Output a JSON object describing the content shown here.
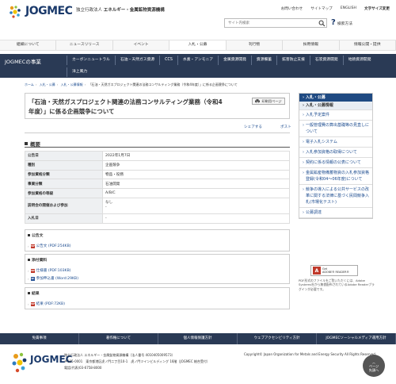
{
  "header": {
    "logo_text": "JOGMEC",
    "org_prefix": "独立行政法人",
    "org_name": "エネルギー・金属鉱物資源機構",
    "top_links": [
      "お問い合わせ",
      "サイトマップ",
      "ENGLISH",
      "文字サイズ変更"
    ],
    "search_placeholder": "サイト内検索",
    "search_help": "検索方法"
  },
  "global_nav": [
    "組織について",
    "ニュースリリース",
    "イベント",
    "入札・公募",
    "刊行物",
    "採用情報",
    "情報公開・提供"
  ],
  "business_bar": {
    "title": "JOGMECの事業",
    "links": [
      "カーボンニュートラル",
      "石油・天然ガス資源",
      "CCS",
      "水素・アンモニア",
      "金属資源開発",
      "資源備蓄",
      "鉱害防止支援",
      "石炭資源開発",
      "地熱資源開発",
      "洋上風力"
    ]
  },
  "breadcrumb": [
    "ホーム",
    "入札・公募",
    "入札・公募情報",
    "「石油・天然ガスプロジェクト関連の法務コンサルティング業務（令和4年度）」に係る企画競争について"
  ],
  "main": {
    "title": "「石油・天然ガスプロジェクト関連の法務コンサルティング業務（令和4年度）」に係る企画競争について",
    "print_label": "印刷用ページ",
    "share_label": "シェアする",
    "post_label": "ポスト",
    "overview_heading": "概要",
    "info_rows": [
      {
        "key": "公告日",
        "value": "2022年1月7日"
      },
      {
        "key": "種別",
        "value": "企画競争"
      },
      {
        "key": "参加資格分類",
        "value": "物品・役務"
      },
      {
        "key": "事業分類",
        "value": "石油開発"
      },
      {
        "key": "参加資格の等級",
        "value": "A/B/C"
      },
      {
        "key": "説明会の開催および参加",
        "value": "なし\n-"
      },
      {
        "key": "入札日",
        "value": "-"
      }
    ],
    "docs": [
      {
        "heading": "公告文",
        "items": [
          {
            "label": "公告文 (PDF:254KB)",
            "icon": "pdf-icon"
          }
        ]
      },
      {
        "heading": "添付資料",
        "items": [
          {
            "label": "仕様書 (PDF:103KB)",
            "icon": "pdf-icon"
          },
          {
            "label": "参加申込書 (Word:29KB)",
            "icon": "word-icon"
          }
        ]
      },
      {
        "heading": "結果",
        "items": [
          {
            "label": "結果 (PDF:72KB)",
            "icon": "pdf-icon"
          }
        ]
      }
    ]
  },
  "sidebar": {
    "heading": "入札・公募",
    "sub_heading": "入札・公募情報",
    "items": [
      "入札予定案件",
      "一般管理費の算出基礎等の見直しについて",
      "電子入札システム",
      "入札参加資格の取得について",
      "契約に係る情報の公表について",
      "金属鉱産物備蓄物資の入札参加資格登録(令和04～06年度)について",
      "競争の導入による公共サービスの改革に関する法律に基づく民間競争入札(市場化テスト)",
      "公募調達"
    ]
  },
  "adobe": {
    "get_label": "Get",
    "product_label": "ADOBE® READER®",
    "note": "PDF形式のファイルをご覧いただくには、Adobe Systems社から無償配布されているAdobe Readerプラグインが必要です。"
  },
  "footer_nav": [
    "免責事項",
    "著作権について",
    "個人情報保護方針",
    "ウェブアクセシビリティ方針",
    "JOGMECソーシャルメディア運用方針"
  ],
  "footer": {
    "logo_text": "JOGMEC",
    "address_lines": [
      "独立行政法人 エネルギー・金属鉱物資源機構（法人番号 4010405009573）",
      "〒105-0001　東京都港区虎ノ門二丁目10-1　虎ノ門ツインビルディング 16階（JOGMEC 総合受付）",
      "電話(代表)03-6758-8000"
    ],
    "copyright": "Copyright© Japan Organization for Metals and Energy Security All Rights Reserved.",
    "pagetop": [
      "ページ",
      "先頭へ"
    ]
  },
  "colors": {
    "navy": "#2a3a55",
    "blue": "#1f4a82",
    "link": "#1b4b8f"
  }
}
